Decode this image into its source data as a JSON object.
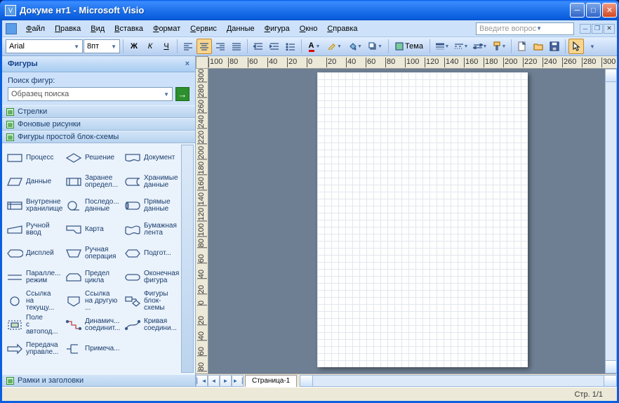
{
  "titlebar": {
    "title": "Докуме нт1 - Microsoft Visio"
  },
  "menu": {
    "items": [
      "Файл",
      "Правка",
      "Вид",
      "Вставка",
      "Формат",
      "Сервис",
      "Данные",
      "Фигура",
      "Окно",
      "Справка"
    ],
    "ask_placeholder": "Введите вопрос"
  },
  "toolbar": {
    "font": "Arial",
    "size": "8пт",
    "theme_label": "Тема",
    "bold": "Ж",
    "italic": "К",
    "underline": "Ч"
  },
  "shapes_pane": {
    "title": "Фигуры",
    "search_label": "Поиск фигур:",
    "search_placeholder": "Образец поиска",
    "stencils": [
      "Стрелки",
      "Фоновые рисунки",
      "Фигуры простой блок-схемы"
    ],
    "footer_stencil": "Рамки и заголовки",
    "shapes": [
      [
        {
          "n": "Процесс",
          "svg": "<rect x='2' y='4' width='20' height='10'/>"
        },
        {
          "n": "Решение",
          "svg": "<polygon points='12,3 22,9 12,15 2,9'/>"
        },
        {
          "n": "Документ",
          "svg": "<path d='M2 4h20v8c-3 3-6-2-10 0s-7 2-10 0z'/>"
        }
      ],
      [
        {
          "n": "Данные",
          "svg": "<polygon points='6,4 22,4 18,14 2,14'/>"
        },
        {
          "n": "Заранее определ...",
          "svg": "<rect x='2' y='4' width='20' height='10'/><line x1='6' y1='4' x2='6' y2='14'/><line x1='18' y1='4' x2='18' y2='14'/>"
        },
        {
          "n": "Хранимые данные",
          "svg": "<path d='M6 4h16a4 5 0 0 0 0 10H6a4 5 0 0 1 0-10z'/>"
        }
      ],
      [
        {
          "n": "Внутренне хранилище",
          "svg": "<rect x='2' y='4' width='20' height='10'/><line x1='2' y1='7' x2='22' y2='7'/><line x1='6' y1='4' x2='6' y2='14'/>"
        },
        {
          "n": "Последо... данные",
          "svg": "<circle cx='10' cy='9' r='6'/><line x1='10' y1='15' x2='20' y2='15'/>"
        },
        {
          "n": "Прямые данные",
          "svg": "<path d='M4 4h14a4 5 0 0 1 0 10H4z'/><ellipse cx='4' cy='9' rx='2' ry='5'/>"
        }
      ],
      [
        {
          "n": "Ручной ввод",
          "svg": "<polygon points='2,8 22,4 22,14 2,14'/>"
        },
        {
          "n": "Карта",
          "svg": "<polygon points='2,4 22,4 22,14 16,14 12,10 2,10'/>"
        },
        {
          "n": "Бумажная лента",
          "svg": "<path d='M2 6c3-3 7 2 10 0s7-3 10 0v8c-3 3-7-2-10 0s-7 3-10 0z'/>"
        }
      ],
      [
        {
          "n": "Дисплей",
          "svg": "<path d='M6 4h12a6 5 0 0 1 0 10H6l-4-5z'/>"
        },
        {
          "n": "Ручная операция",
          "svg": "<polygon points='2,4 22,4 18,14 6,14'/>"
        },
        {
          "n": "Подгот...",
          "svg": "<polygon points='6,4 18,4 22,9 18,14 6,14 2,9'/>"
        }
      ],
      [
        {
          "n": "Паралле... режим",
          "svg": "<line x1='2' y1='6' x2='22' y2='6'/><line x1='2' y1='12' x2='22' y2='12'/>"
        },
        {
          "n": "Предел цикла",
          "svg": "<polygon points='6,4 18,4 22,8 22,14 2,14 2,8'/>"
        },
        {
          "n": "Оконечная фигура",
          "svg": "<rect x='2' y='5' width='20' height='8' rx='4'/>"
        }
      ],
      [
        {
          "n": "Ссылка на текущу...",
          "svg": "<circle cx='12' cy='9' r='6'/>"
        },
        {
          "n": "Ссылка на другую ...",
          "svg": "<polygon points='4,3 20,3 20,11 12,16 4,11'/>"
        },
        {
          "n": "Фигуры блок-схемы",
          "svg": "<rect x='2' y='3' width='9' height='6'/><polygon points='17,8 22,12 17,16 12,12'/><line x1='11' y1='6' x2='17' y2='6'/><line x1='17' y1='6' x2='17' y2='8'/>"
        }
      ],
      [
        {
          "n": "Поле с автопод...",
          "svg": "<rect x='3' y='3' width='18' height='12' stroke-dasharray='2'/><rect x='7' y='6' width='10' height='6' fill='#c8e0b8'/>"
        },
        {
          "n": "Динамич... соединит...",
          "svg": "<path d='M3 4h6v5h6v5h6' stroke='#c04040'/><circle cx='3' cy='4' r='1.5' fill='#3b5a8a'/><circle cx='21' cy='14' r='1.5' fill='#3b5a8a'/>"
        },
        {
          "n": "Кривая соедини...",
          "svg": "<path d='M3 14 C8 4 16 14 21 4'/><circle cx='3' cy='14' r='1.5' fill='#3b5a8a'/><circle cx='21' cy='4' r='1.5' fill='#3b5a8a'/>"
        }
      ],
      [
        {
          "n": "Передача управле...",
          "svg": "<polygon points='2,6 16,6 16,3 22,9 16,15 16,12 2,12'/>"
        },
        {
          "n": "Примеча...",
          "svg": "<path d='M8 3v12M8 3h10M8 15h10'/><line x1='2' y1='9' x2='8' y2='9'/>"
        },
        {
          "n": "",
          "svg": ""
        }
      ]
    ]
  },
  "canvas": {
    "page_tab": "Страница-1"
  },
  "status": {
    "page": "Стр. 1/1"
  },
  "ruler_h": [
    -100,
    -80,
    -60,
    -40,
    -20,
    0,
    20,
    40,
    60,
    80,
    100,
    120,
    140,
    160,
    180,
    200,
    220,
    240,
    260,
    280,
    300
  ],
  "ruler_v": [
    300,
    280,
    260,
    240,
    220,
    200,
    180,
    160,
    140,
    120,
    100,
    80,
    60,
    40,
    20,
    0,
    -20,
    -40,
    -60,
    -80
  ]
}
